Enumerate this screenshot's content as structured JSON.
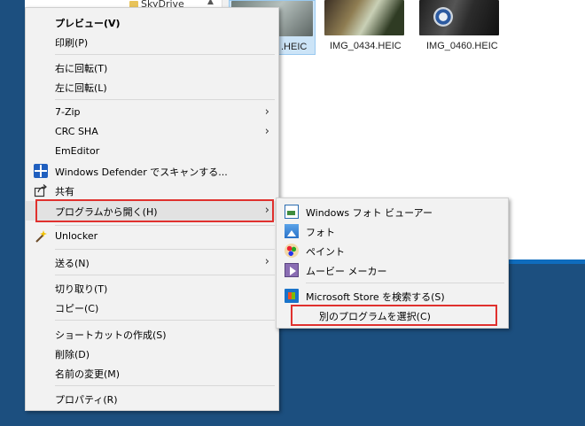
{
  "explorer": {
    "nav_folder_label": "SkyDrive",
    "thumbnails": [
      {
        "label": ".HEIC",
        "selected": true
      },
      {
        "label": "IMG_0434.HEIC",
        "selected": false
      },
      {
        "label": "IMG_0460.HEIC",
        "selected": false
      }
    ]
  },
  "context_menu": {
    "items": {
      "preview": "プレビュー(V)",
      "print": "印刷(P)",
      "rotate_right": "右に回転(T)",
      "rotate_left": "左に回転(L)",
      "seven_zip": "7-Zip",
      "crc_sha": "CRC SHA",
      "emeditor": "EmEditor",
      "defender_scan": "Windows Defender でスキャンする...",
      "share": "共有",
      "open_with": "プログラムから開く(H)",
      "unlocker": "Unlocker",
      "send_to": "送る(N)",
      "cut": "切り取り(T)",
      "copy": "コピー(C)",
      "create_shortcut": "ショートカットの作成(S)",
      "delete": "削除(D)",
      "rename": "名前の変更(M)",
      "properties": "プロパティ(R)"
    }
  },
  "open_with_submenu": {
    "items": {
      "photo_viewer": "Windows フォト ビューアー",
      "photos": "フォト",
      "paint": "ペイント",
      "movie_maker": "ムービー メーカー",
      "store_search": "Microsoft Store を検索する(S)",
      "choose_other": "別のプログラムを選択(C)"
    }
  },
  "colors": {
    "highlight_border": "#e0312e",
    "desktop": "#1c4f7f",
    "menu_bg": "#f2f2f2"
  }
}
